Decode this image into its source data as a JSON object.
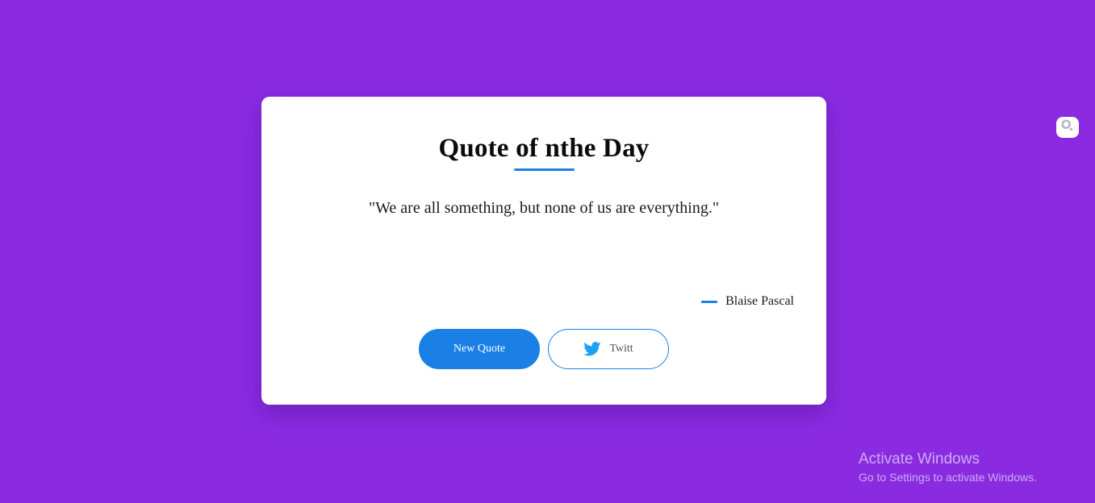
{
  "card": {
    "title": "Quote of nthe Day",
    "quote": "\"We are all something, but none of us are everything.\"",
    "author": "Blaise Pascal",
    "new_quote_label": "New Quote",
    "tweet_label": "Twitt"
  },
  "side_widget": {
    "icon": "search-icon"
  },
  "watermark": {
    "title": "Activate Windows",
    "subtitle": "Go to Settings to activate Windows."
  },
  "colors": {
    "background": "#8a2be2",
    "accent": "#1a80e6",
    "twitter": "#1da1f2"
  }
}
